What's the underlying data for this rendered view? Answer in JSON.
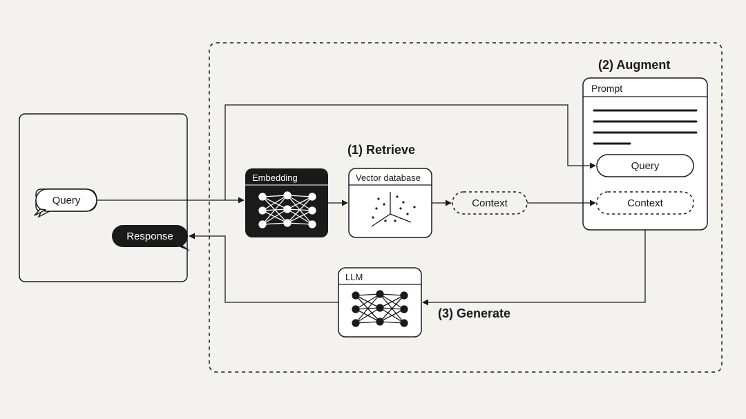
{
  "steps": {
    "retrieve": "(1) Retrieve",
    "augment": "(2) Augment",
    "generate": "(3) Generate"
  },
  "bubbles": {
    "query": "Query",
    "response": "Response",
    "context": "Context"
  },
  "boxes": {
    "embedding": "Embedding",
    "vector_db": "Vector database",
    "llm": "LLM",
    "prompt_title": "Prompt",
    "prompt_query": "Query",
    "prompt_context": "Context"
  }
}
